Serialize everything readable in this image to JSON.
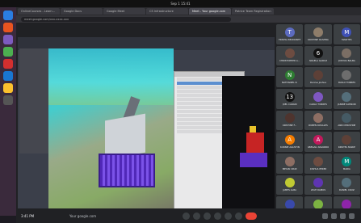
{
  "browser": {
    "tabs": [
      "OnlineCourses - Learn...",
      "Google Docs",
      "Google Meet",
      "CS Infrastructure",
      "Meet - Your google.com",
      "Patrice Team Registration"
    ],
    "url": "meet.google.com/xxx-xxxx-xxx"
  },
  "meeting": {
    "time": "3:41 PM",
    "code": "Your google.com",
    "participants": [
      {
        "initial": "T",
        "name": "TRISHIA BELMONTE",
        "color": "#5c6bc0"
      },
      {
        "initial": "",
        "name": "KRISTINE OLIVERA",
        "color": "#8e7d6a"
      },
      {
        "initial": "M",
        "name": "MARITES",
        "color": "#3f51b5"
      },
      {
        "initial": "",
        "name": "CHRISTOPHER A...",
        "color": "#6d4c41"
      },
      {
        "initial": "6",
        "name": "ANGELA GARCIA",
        "color": "#111111"
      },
      {
        "initial": "",
        "name": "JOSHUA BALBA",
        "color": "#7b6e64"
      },
      {
        "initial": "N",
        "name": "NATHANIEL R.",
        "color": "#2e7d32"
      },
      {
        "initial": "",
        "name": "Deniva Joshua",
        "color": "#5d4037"
      },
      {
        "initial": "",
        "name": "PAOLO TORRES",
        "color": "#6d6d6d"
      },
      {
        "initial": "13",
        "name": "JOEL CARANI",
        "color": "#111111"
      },
      {
        "initial": "",
        "name": "CARLO TORRES",
        "color": "#7e57c2"
      },
      {
        "initial": "",
        "name": "JANINE SAMSON",
        "color": "#546e7a"
      },
      {
        "initial": "",
        "name": "KRISTINE F...",
        "color": "#4e342e"
      },
      {
        "initial": "",
        "name": "RUBEN ROSALES",
        "color": "#8d6e63"
      },
      {
        "initial": "",
        "name": "ANN CHRISTINE",
        "color": "#455a64"
      },
      {
        "initial": "A",
        "name": "RONNIE AGUSTIN",
        "color": "#f57c00"
      },
      {
        "initial": "A",
        "name": "ABEGAIL NAVARRO",
        "color": "#c2185b"
      },
      {
        "initial": "",
        "name": "KRISTEL MARIE",
        "color": "#5d4037"
      },
      {
        "initial": "",
        "name": "BRYAN CRUZ",
        "color": "#8d6e63"
      },
      {
        "initial": "",
        "name": "JOSHUA PEREZ",
        "color": "#6d4c41"
      },
      {
        "initial": "M",
        "name": "MARIA",
        "color": "#00897b"
      },
      {
        "initial": "",
        "name": "JAMES ALBA",
        "color": "#c0ca33"
      },
      {
        "initial": "",
        "name": "LEAH RAMOS",
        "color": "#5e35b1"
      },
      {
        "initial": "",
        "name": "DANIEL CRUZ",
        "color": "#546e7a"
      },
      {
        "initial": "",
        "name": "TANGALA GAAD",
        "color": "#3949ab"
      },
      {
        "initial": "",
        "name": "SHARIELLE DMLT",
        "color": "#7cb342"
      },
      {
        "initial": "",
        "name": "JOANNA",
        "color": "#8e24aa"
      }
    ]
  }
}
